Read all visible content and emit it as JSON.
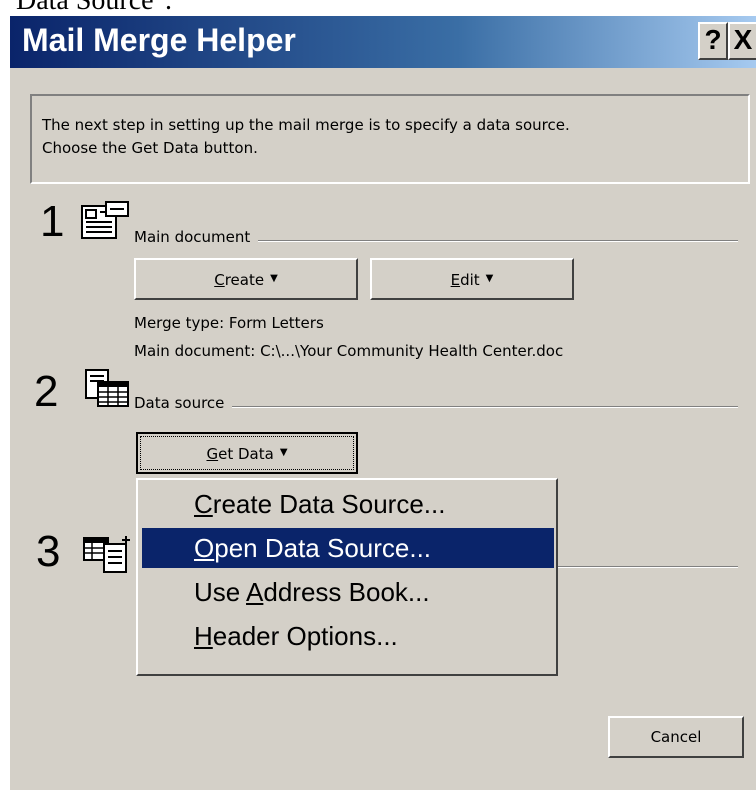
{
  "caption": "Data Source\".",
  "dialog": {
    "title": "Mail Merge Helper",
    "help_label": "?",
    "close_label": "X",
    "instruction_line1": "The next step in setting up the mail merge is to specify a data source.",
    "instruction_line2": "Choose the Get Data button."
  },
  "step1": {
    "number": "1",
    "icon": "main-document-icon",
    "label": "Main document",
    "create_button": {
      "label_underlined": "C",
      "label_rest": "reate"
    },
    "edit_button": {
      "label_underlined": "E",
      "label_rest": "dit"
    },
    "merge_type": "Merge type: Form Letters",
    "main_document": "Main document: C:\\...\\Your Community Health Center.doc"
  },
  "step2": {
    "number": "2",
    "icon": "data-source-icon",
    "label": "Data source",
    "get_data_button": {
      "label_underlined": "G",
      "label_rest": "et Data"
    }
  },
  "step3": {
    "number": "3",
    "icon": "merge-icon"
  },
  "dropdown_menu": {
    "items": [
      {
        "underlined": "C",
        "rest": "reate Data Source...",
        "pre": "",
        "selected": false
      },
      {
        "underlined": "O",
        "rest": "pen Data Source...",
        "pre": "",
        "selected": true
      },
      {
        "pre": "Use ",
        "underlined": "A",
        "rest": "ddress Book...",
        "selected": false
      },
      {
        "underlined": "H",
        "rest": "eader Options...",
        "pre": "",
        "selected": false
      }
    ]
  },
  "cancel_label": "Cancel",
  "colors": {
    "dialog_face": "#d4d0c8",
    "title_gradient_start": "#0a246a",
    "title_gradient_end": "#a6caf0",
    "menu_highlight": "#0a246a"
  }
}
